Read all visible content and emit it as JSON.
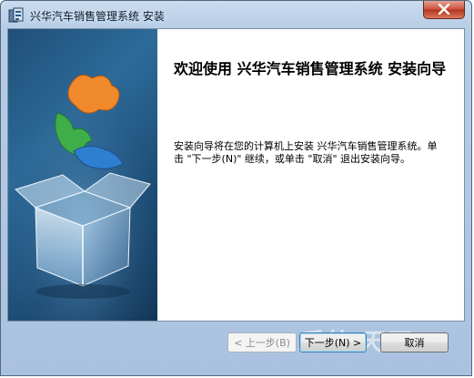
{
  "window": {
    "title": "兴华汽车销售管理系统 安装"
  },
  "welcome": {
    "heading": "欢迎使用  兴华汽车销售管理系统  安装向导",
    "body": "安装向导将在您的计算机上安装 兴华汽车销售管理系统。单击 \"下一步(N)\" 继续，或单击 \"取消\" 退出安装向导。"
  },
  "buttons": {
    "back": "< 上一步(B)",
    "next": "下一步(N) >",
    "cancel": "取消"
  },
  "watermark": "系统·天下",
  "icons": {
    "title": "installer-icon",
    "close": "close-icon",
    "side": "puzzle-box-icon"
  }
}
